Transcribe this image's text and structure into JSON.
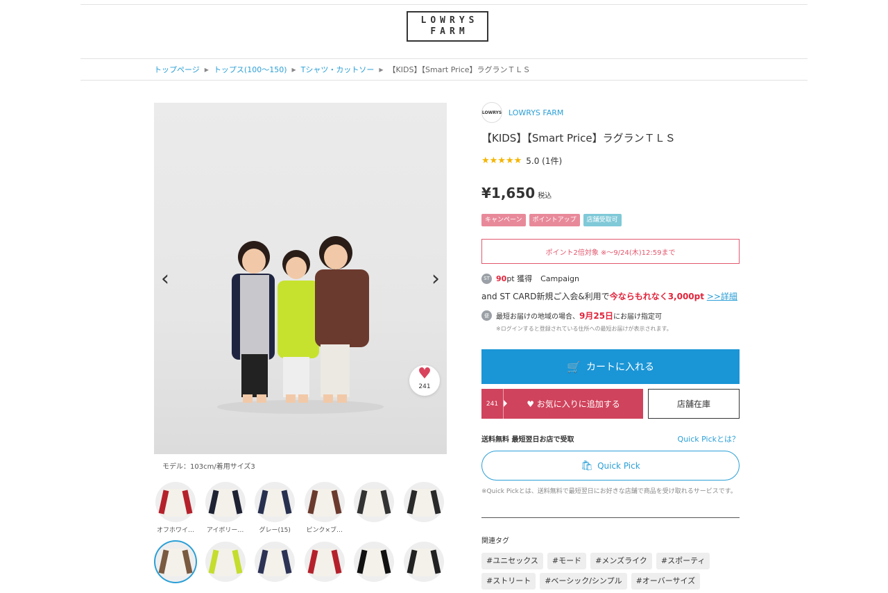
{
  "header": {
    "logo_line1": "LOWRYS",
    "logo_line2": "FARM"
  },
  "breadcrumb": [
    "トップページ",
    "トップス(100〜150)",
    "Tシャツ・カットソー",
    "【KIDS】【Smart Price】ラグランＴＬＳ"
  ],
  "gallery": {
    "model_note": "モデル：103cm/着用サイズ3",
    "favorite_count": "241",
    "thumb_row1": [
      {
        "label": "オフホワイ…",
        "color": "#b5212b"
      },
      {
        "label": "アイボリー…",
        "color": "#1e2233"
      },
      {
        "label": "グレー(15)",
        "color": "#28304f"
      },
      {
        "label": "ピンク×ブ…",
        "color": "#6b3a2e"
      },
      {
        "label": "",
        "color": "#333333"
      },
      {
        "label": "",
        "color": "#2a2a2a"
      }
    ],
    "thumb_row2": [
      {
        "label": "",
        "color": "#7a5a40"
      },
      {
        "label": "",
        "color": "#c5dd2d"
      },
      {
        "label": "",
        "color": "#2c3355"
      },
      {
        "label": "",
        "color": "#b5212b"
      },
      {
        "label": "",
        "color": "#111111"
      },
      {
        "label": "",
        "color": "#222222"
      }
    ]
  },
  "product": {
    "brand_icon_text": "LOWRYS",
    "brand": "LOWRYS FARM",
    "title": "【KIDS】【Smart Price】ラグランＴＬＳ",
    "stars": "★★★★★",
    "rating": "5.0 (1件)",
    "price": "¥1,650",
    "tax_label": "税込",
    "badges": [
      {
        "label": "キャンペーン",
        "color": "#e8899a"
      },
      {
        "label": "ポイントアップ",
        "color": "#e8899a"
      },
      {
        "label": "店舗受取可",
        "color": "#7fc9d8"
      }
    ],
    "campaign_box": "ポイント2倍対象 ※〜9/24(木)12:59まで",
    "points_icon": "ST",
    "points_value": "90",
    "points_suffix": "pt 獲得",
    "points_campaign": "Campaign",
    "card_text": "and ST CARD新規ご入会&利用で",
    "card_highlight": "今ならもれなく3,000pt",
    "card_link": ">>詳細",
    "delivery_icon": "便",
    "delivery_prefix": "最短お届けの地域の場合、",
    "delivery_date": "9月25日",
    "delivery_suffix": "にお届け指定可",
    "delivery_note": "※ログインすると登録されている住所への最短お届けが表示されます。",
    "cart_label": "カートに入れる",
    "fav_count": "241",
    "fav_label": "お気に入りに追加する",
    "store_label": "店舗在庫",
    "ship_left": "送料無料 最短翌日お店で受取",
    "ship_right": "Quick Pickとは？",
    "quickpick_label": "Quick Pick",
    "quickpick_note": "※Quick Pickとは、送料無料で最短翌日にお好きな店舗で商品を受け取れるサービスです。",
    "tags_title": "関連タグ",
    "tags": [
      "#ユニセックス",
      "#モード",
      "#メンズライク",
      "#スポーティ",
      "#ストリート",
      "#ベーシック/シンプル",
      "#オーバーサイズ"
    ]
  },
  "icons": {
    "prev": "chevron-left-icon",
    "next": "chevron-right-icon",
    "heart": "heart-icon",
    "cart": "cart-icon",
    "bag": "bag-icon"
  },
  "colors": {
    "accent_blue": "#1a95d6",
    "favorite_red": "#d0435c",
    "highlight_red": "#e2243b"
  }
}
